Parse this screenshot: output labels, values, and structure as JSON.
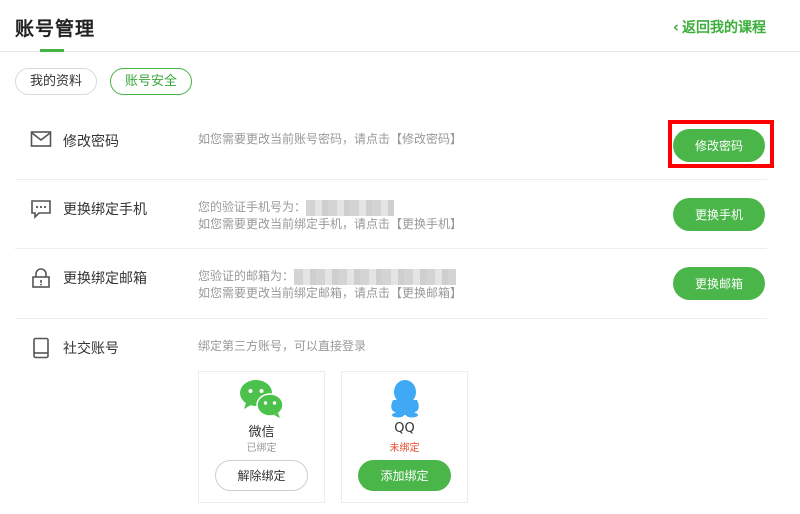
{
  "header": {
    "title": "账号管理",
    "back_label": "返回我的课程"
  },
  "tabs": [
    {
      "label": "我的资料",
      "active": false
    },
    {
      "label": "账号安全",
      "active": true
    }
  ],
  "rows": {
    "password": {
      "label": "修改密码",
      "desc": "如您需要更改当前账号密码，请点击【修改密码】",
      "button": "修改密码"
    },
    "phone": {
      "label": "更换绑定手机",
      "desc1": "您的验证手机号为：",
      "desc2": "如您需要更改当前绑定手机，请点击【更换手机】",
      "button": "更换手机"
    },
    "email": {
      "label": "更换绑定邮箱",
      "desc1": "您验证的邮箱为：",
      "desc2": "如您需要更改当前绑定邮箱，请点击【更换邮箱】",
      "button": "更换邮箱"
    },
    "social": {
      "label": "社交账号",
      "desc": "绑定第三方账号，可以直接登录"
    }
  },
  "social_accounts": [
    {
      "name": "微信",
      "status": "已绑定",
      "button": "解除绑定",
      "status_color": "#999999"
    },
    {
      "name": "QQ",
      "status": "未绑定",
      "button": "添加绑定",
      "status_color": "#e84b2c"
    }
  ],
  "colors": {
    "accent": "#4ab64a",
    "highlight": "#ff0000",
    "wechat": "#4cc24c",
    "qq": "#3fa9f5"
  },
  "icons": {
    "back": "chevron-left-icon",
    "password": "mail-icon",
    "phone": "message-icon",
    "email": "lock-icon",
    "social": "tablet-icon"
  }
}
